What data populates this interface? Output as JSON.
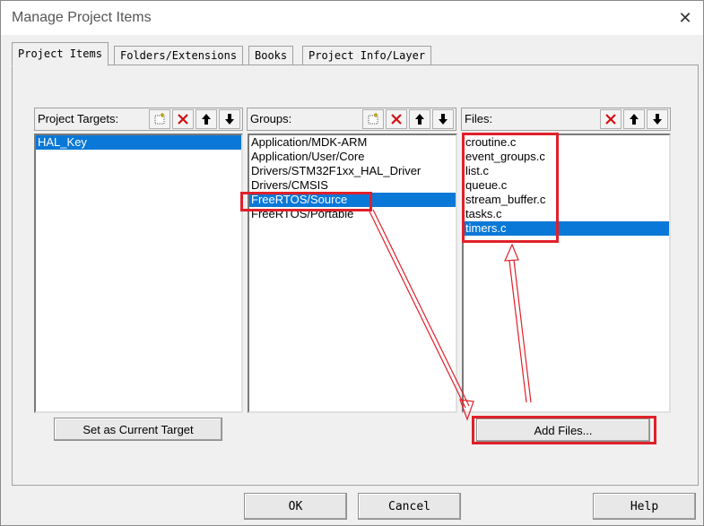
{
  "window": {
    "title": "Manage Project Items"
  },
  "tabs": [
    {
      "label": "Project Items"
    },
    {
      "label": "Folders/Extensions"
    },
    {
      "label": "Books"
    },
    {
      "label": "Project Info/Layer"
    }
  ],
  "targets": {
    "label": "Project Targets:",
    "items": [
      "HAL_Key"
    ]
  },
  "groups": {
    "label": "Groups:",
    "items": [
      "Application/MDK-ARM",
      "Application/User/Core",
      "Drivers/STM32F1xx_HAL_Driver",
      "Drivers/CMSIS",
      "FreeRTOS/Source",
      "FreeRTOS/Portable"
    ]
  },
  "files": {
    "label": "Files:",
    "items": [
      "croutine.c",
      "event_groups.c",
      "list.c",
      "queue.c",
      "stream_buffer.c",
      "tasks.c",
      "timers.c"
    ]
  },
  "buttons": {
    "set_target": "Set as Current Target",
    "add_files": "Add Files...",
    "ok": "OK",
    "cancel": "Cancel",
    "help": "Help"
  },
  "colors": {
    "selection": "#0a78d7",
    "annotation": "#e0202a"
  },
  "icons": [
    "new-item-icon",
    "delete-icon",
    "move-up-icon",
    "move-down-icon",
    "close-icon"
  ]
}
